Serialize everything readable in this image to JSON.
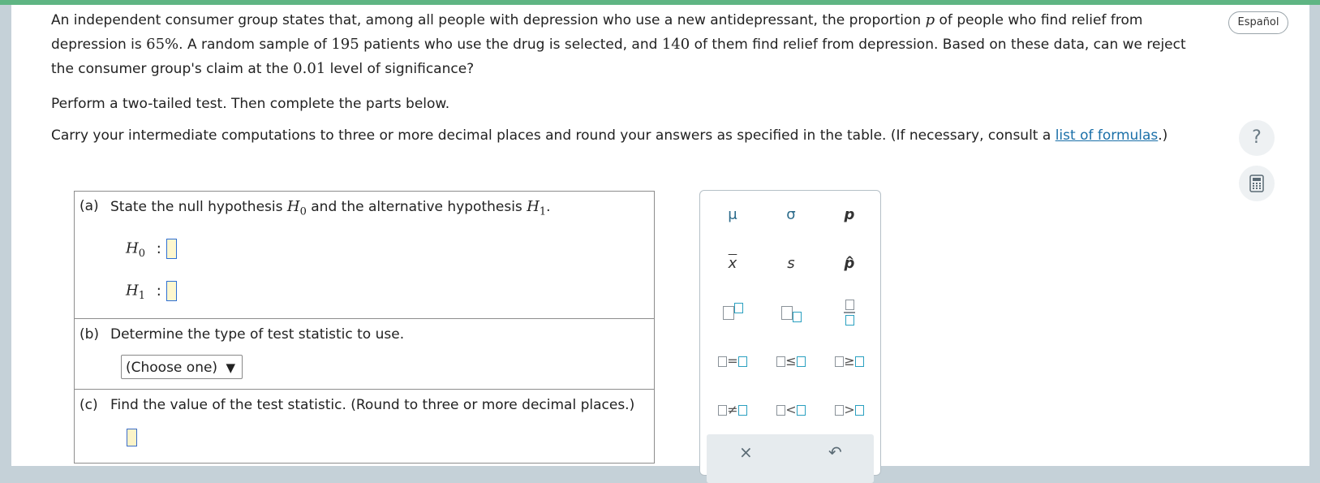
{
  "problem": {
    "intro_1": "An independent consumer group states that, among all people with depression who use a new antidepressant, the proportion ",
    "p_symbol": "p",
    "intro_2": " of people who find relief from depression is ",
    "claim_pct": "65%",
    "intro_3": ". A random sample of ",
    "n": "195",
    "intro_4": " patients who use the drug is selected, and ",
    "x": "140",
    "intro_5": " of them find relief from depression. Based on these data, can we reject the consumer group's claim at the ",
    "alpha": "0.01",
    "intro_6": " level of significance?",
    "instruction": "Perform a two-tailed test. Then complete the parts below.",
    "carry_1": "Carry your intermediate computations to three or more decimal places and round your answers as specified in the table. (If necessary, consult a ",
    "formulas_link": "list of formulas",
    "carry_2": ".)"
  },
  "header": {
    "language_button": "Español",
    "help_glyph": "?"
  },
  "parts": {
    "a": {
      "label": "(a)",
      "text_1": "State the null hypothesis ",
      "H0": "H",
      "H0_sub": "0",
      "text_2": " and the alternative hypothesis ",
      "H1": "H",
      "H1_sub": "1",
      "text_3": ".",
      "row_h0_sym": "H",
      "row_h0_sub": "0",
      "row_h1_sym": "H",
      "row_h1_sub": "1",
      "colon": ":"
    },
    "b": {
      "label": "(b)",
      "text": "Determine the type of test statistic to use.",
      "select_value": "(Choose one)",
      "arrow": "▼"
    },
    "c": {
      "label": "(c)",
      "text": "Find the value of the test statistic. (Round to three or more decimal places.)"
    }
  },
  "palette": {
    "mu": "μ",
    "sigma": "σ",
    "p": "p",
    "xbar": "x",
    "s": "s",
    "phat": "p",
    "eq": "=",
    "le": "≤",
    "ge": "≥",
    "ne": "≠",
    "lt": "<",
    "gt": ">",
    "clear": "×",
    "undo": "↶"
  }
}
